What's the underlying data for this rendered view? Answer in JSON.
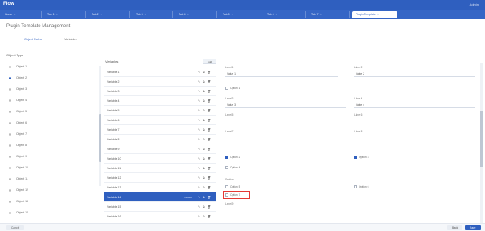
{
  "app": {
    "logo": "Flow",
    "user": "Admin"
  },
  "tabs": [
    {
      "label": "Home"
    },
    {
      "label": "Tab 1"
    },
    {
      "label": "Tab 2"
    },
    {
      "label": "Tab 3"
    },
    {
      "label": "Tab 4"
    },
    {
      "label": "Tab 5"
    },
    {
      "label": "Tab 6"
    },
    {
      "label": "Tab 7"
    },
    {
      "label": "Plugin Template"
    }
  ],
  "page": {
    "title": "Plugin Template Management"
  },
  "subtabs": [
    {
      "label": "Object Rules"
    },
    {
      "label": "Variables"
    }
  ],
  "left": {
    "header": "Object Type",
    "items": [
      "Object 1",
      "Object 2",
      "Object 3",
      "Object 4",
      "Object 5",
      "Object 6",
      "Object 7",
      "Object 8",
      "Object 9",
      "Object 10",
      "Object 11",
      "Object 12",
      "Object 13",
      "Object 14"
    ]
  },
  "middle": {
    "header": "Variables",
    "add_label": "Add",
    "rows": [
      "Variable 1",
      "Variable 2",
      "Variable 3",
      "Variable 4",
      "Variable 5",
      "Variable 6",
      "Variable 7",
      "Variable 8",
      "Variable 9",
      "Variable 10",
      "Variable 11",
      "Variable 12",
      "Variable 13",
      "Variable 14",
      "Variable 15",
      "Variable 16"
    ],
    "selected_tag": "Default",
    "actions": "✎ ⧉ 🗑"
  },
  "right": {
    "f1_label": "Label 1",
    "f1_value": "Value 1",
    "f2_label": "Label 2",
    "f2_value": "Value 2",
    "chk1": "Option 1",
    "f3_label": "Label 3",
    "f3_value": "Value 3",
    "f4_label": "Label 4",
    "f4_value": "Value 4",
    "f5_label": "Label 5",
    "f6_label": "Label 6",
    "f7_label": "Label 7",
    "f8_label": "Label 8",
    "chk2": "Option 2",
    "chk3": "Option 3",
    "chk4": "Option 4",
    "section_label": "Section",
    "chk5": "Option 5",
    "chk6": "Option 6",
    "chk7": "Option 7",
    "f9_label": "Label 9"
  },
  "footer": {
    "cancel": "Cancel",
    "back": "Back",
    "save": "Save"
  }
}
